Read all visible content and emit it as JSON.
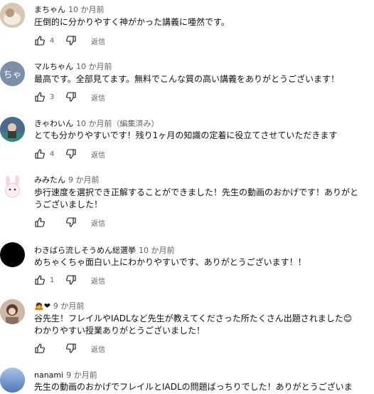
{
  "reply_label": "返信",
  "comments": [
    {
      "author": "まちゃん",
      "time": "10 か月前",
      "text1": "圧倒的に分かりやすく神がかった講義に唖然です。",
      "text2": "",
      "likes": "4"
    },
    {
      "author": "マルちゃん",
      "time": "10 か月前",
      "avatar_text": "ちゃ",
      "text1": "最高です。全部見てます。無料でこんな質の高い講義をありがとうございます！",
      "text2": "",
      "likes": "3"
    },
    {
      "author": "きゃわいん",
      "time": "10 か月前（編集済み）",
      "text1": "とても分かりやすいです！残り1ヶ月の知識の定着に役立てさせていただきます",
      "text2": "",
      "likes": "4"
    },
    {
      "author": "みみたん",
      "time": "9 か月前",
      "text1": "歩行速度を選択でき正解することができました！先生の動画のおかげです！ありがと",
      "text2": "うございました！",
      "likes": ""
    },
    {
      "author": "わきばら流しそうめん総選挙",
      "time": "10 か月前",
      "text1": "めちゃくちゃ面白い上にわかりやすいです、ありがとうございます！！",
      "text2": "",
      "likes": "1"
    },
    {
      "author": "",
      "author_emoji": "🙇❤",
      "time": "9 か月前",
      "text1": "谷先生！フレイルやIADLなど先生が教えてくださった所たくさん出題されました😊",
      "text2": "わかりやすい授業ありがとうございました！",
      "likes": ""
    },
    {
      "author": "nanami",
      "time": "9 か月前",
      "text1": "先生の動画のおかげでフレイルとIADLの問題ばっちりでした！ありがとうございま",
      "text2": "",
      "likes": ""
    }
  ],
  "colors": {
    "text": "#0f0f0f",
    "secondary": "#606060"
  }
}
